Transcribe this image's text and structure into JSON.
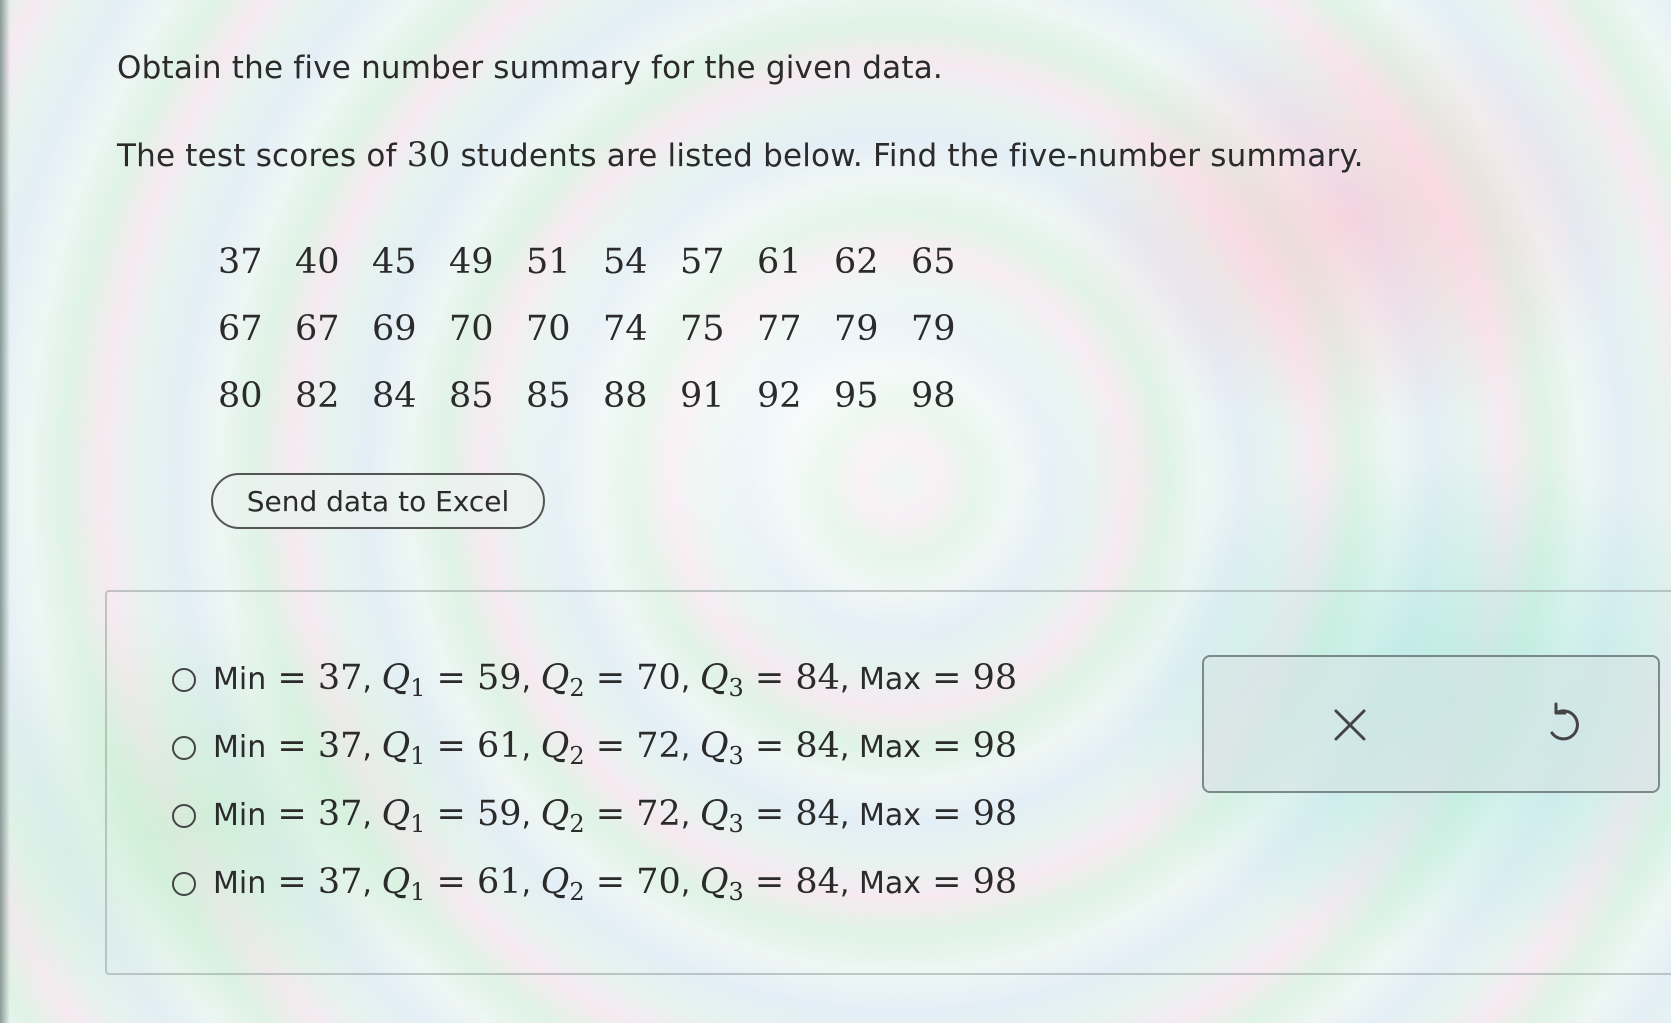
{
  "question": {
    "title": "Obtain the five number summary for the given data.",
    "text_before": "The test scores of ",
    "count": "30",
    "text_after": " students are listed below. Find the five-number summary."
  },
  "data_rows": [
    [
      "37",
      "40",
      "45",
      "49",
      "51",
      "54",
      "57",
      "61",
      "62",
      "65"
    ],
    [
      "67",
      "67",
      "69",
      "70",
      "70",
      "74",
      "75",
      "77",
      "79",
      "79"
    ],
    [
      "80",
      "82",
      "84",
      "85",
      "85",
      "88",
      "91",
      "92",
      "95",
      "98"
    ]
  ],
  "excel_button": "Send data to Excel",
  "options": [
    {
      "min": "37",
      "q1": "59",
      "q2": "70",
      "q3": "84",
      "max": "98"
    },
    {
      "min": "37",
      "q1": "61",
      "q2": "72",
      "q3": "84",
      "max": "98"
    },
    {
      "min": "37",
      "q1": "59",
      "q2": "72",
      "q3": "84",
      "max": "98"
    },
    {
      "min": "37",
      "q1": "61",
      "q2": "70",
      "q3": "84",
      "max": "98"
    }
  ],
  "option_labels": {
    "min": "Min",
    "max": "Max",
    "q": "Q",
    "q1_sub": "1",
    "q2_sub": "2",
    "q3_sub": "3",
    "eq": " = ",
    "sep": ", "
  },
  "tools": {
    "clear_icon": "x-icon",
    "undo_icon": "undo-icon"
  }
}
